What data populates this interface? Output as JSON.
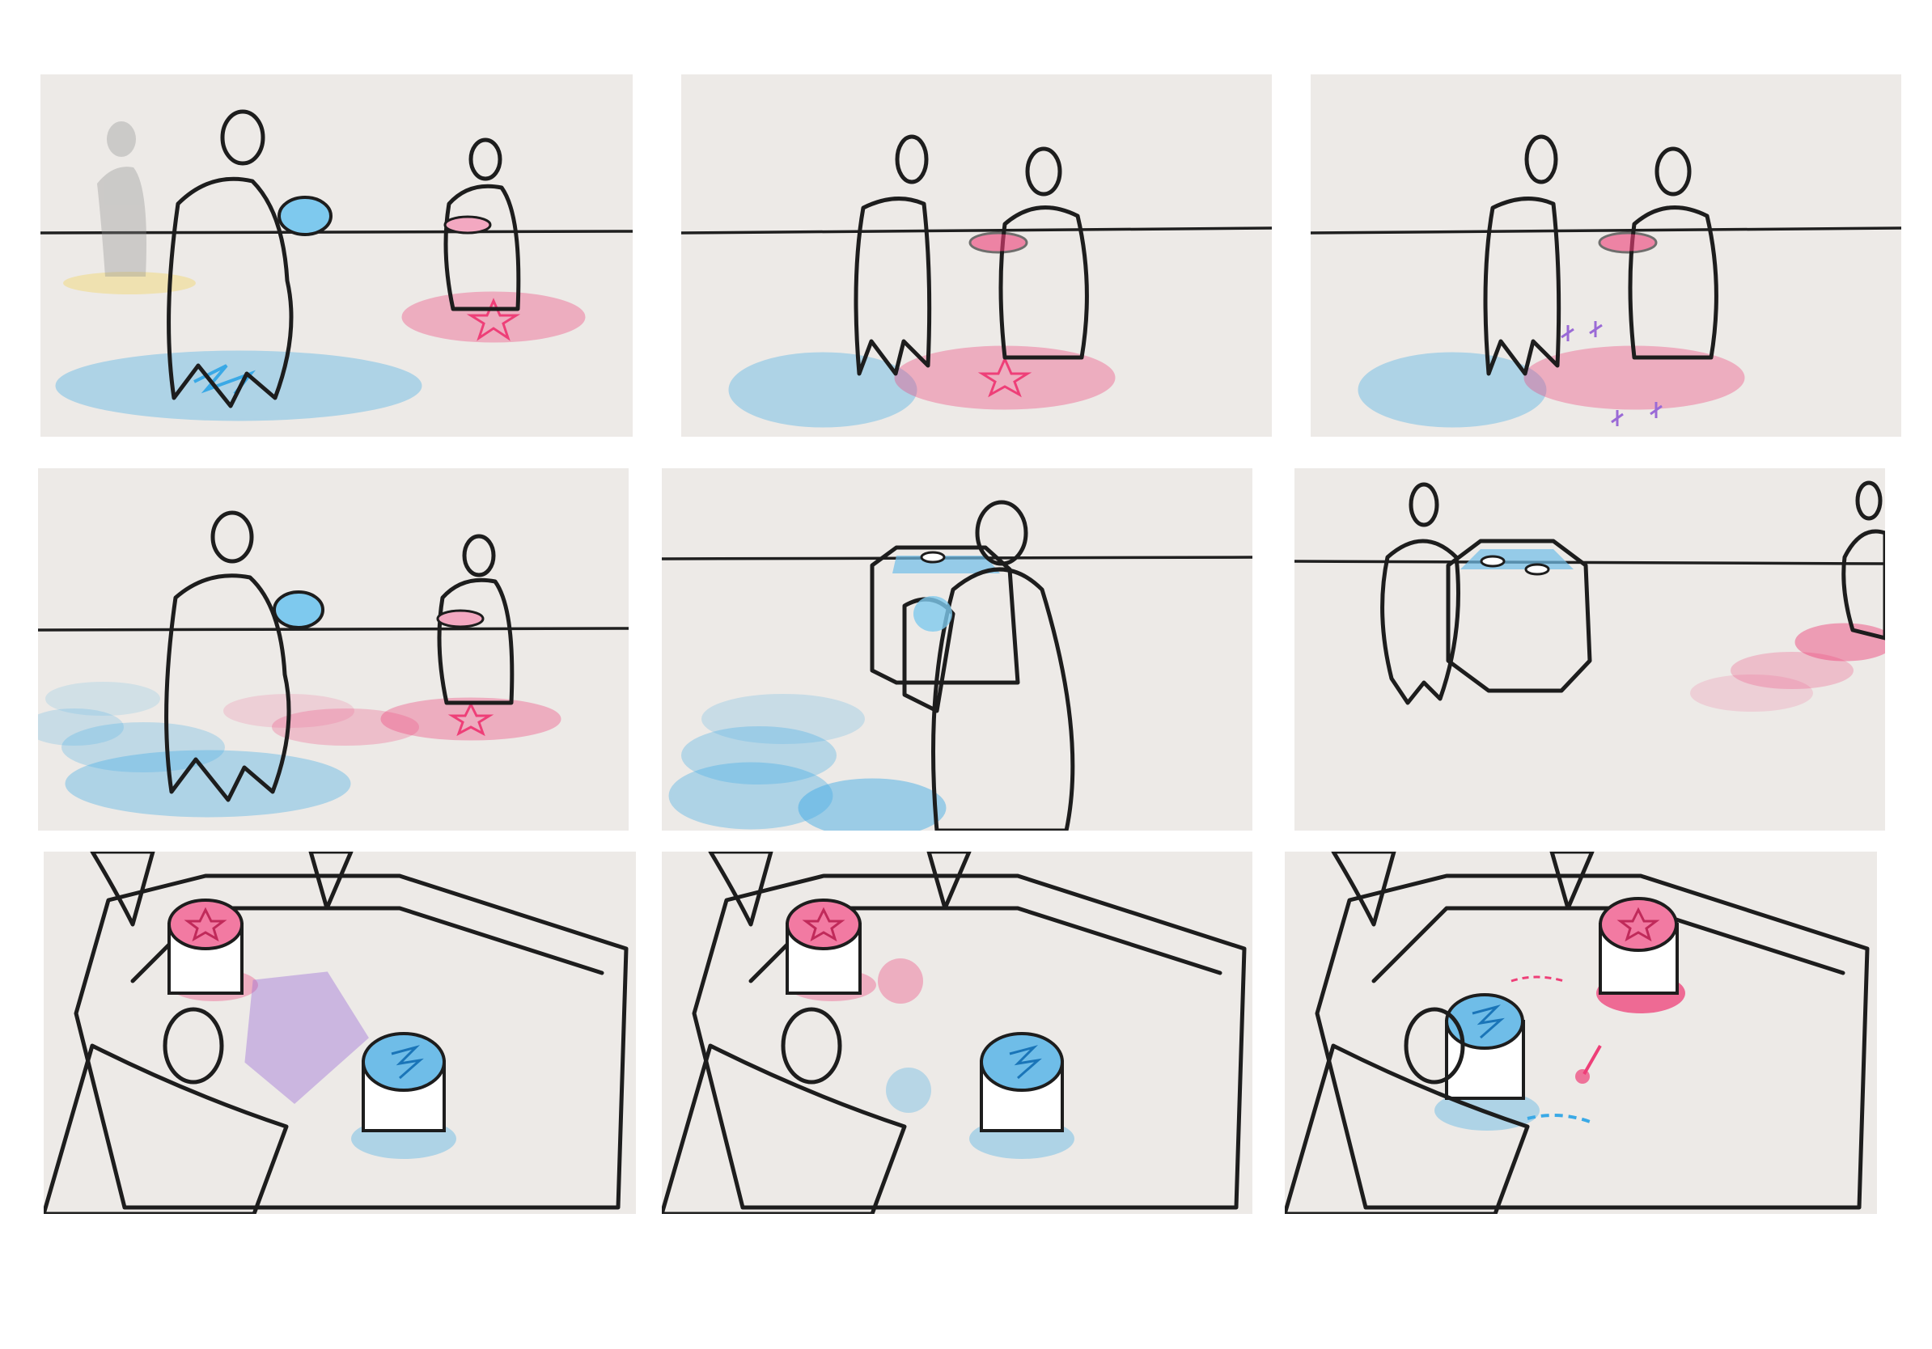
{
  "storyboard": {
    "title": "",
    "panels": [
      {
        "id": "p1",
        "scene": "character",
        "caption": "",
        "colors": [
          "#3aa9e6",
          "#ee3f78",
          "#f4d14a"
        ],
        "icons": [
          "lightning-icon",
          "star-icon"
        ]
      },
      {
        "id": "p2",
        "scene": "character",
        "caption": "",
        "colors": [
          "#3aa9e6",
          "#ee3f78"
        ],
        "icons": [
          "lightning-icon",
          "star-icon"
        ]
      },
      {
        "id": "p3",
        "scene": "character",
        "caption": "",
        "colors": [
          "#3aa9e6",
          "#ee3f78",
          "#9a6ad6"
        ],
        "icons": [
          "lightning-icon",
          "star-icon",
          "sparkle-icon"
        ]
      },
      {
        "id": "p4",
        "scene": "character",
        "caption": "",
        "colors": [
          "#3aa9e6",
          "#ee3f78"
        ],
        "icons": [
          "lightning-icon",
          "star-icon"
        ]
      },
      {
        "id": "p5",
        "scene": "booth",
        "caption": "",
        "colors": [
          "#3aa9e6"
        ],
        "icons": []
      },
      {
        "id": "p6",
        "scene": "booth",
        "caption": "",
        "colors": [
          "#ee3f78",
          "#3aa9e6"
        ],
        "icons": []
      },
      {
        "id": "p7",
        "scene": "table-top",
        "caption": "",
        "colors": [
          "#ee3f78",
          "#3aa9e6",
          "#9a6ad6"
        ],
        "icons": [
          "star-icon",
          "lightning-icon"
        ]
      },
      {
        "id": "p8",
        "scene": "table-top",
        "caption": "",
        "colors": [
          "#ee3f78",
          "#3aa9e6"
        ],
        "icons": [
          "star-icon",
          "lightning-icon"
        ]
      },
      {
        "id": "p9",
        "scene": "table-top",
        "caption": "",
        "colors": [
          "#ee3f78",
          "#3aa9e6"
        ],
        "icons": [
          "star-icon",
          "lightning-icon",
          "arrow-icon"
        ]
      }
    ]
  }
}
